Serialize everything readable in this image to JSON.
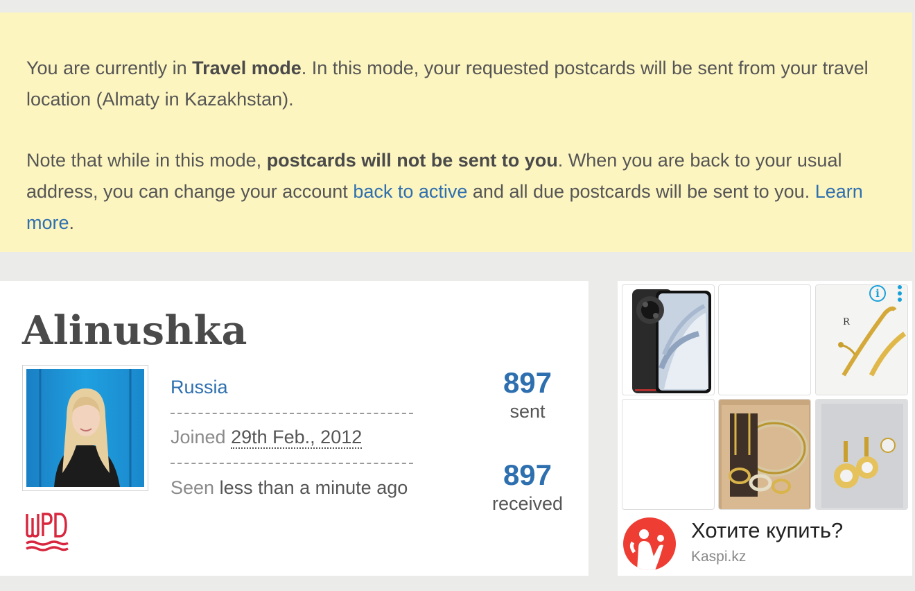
{
  "notice": {
    "p1_before": "You are currently in ",
    "p1_bold": "Travel mode",
    "p1_after": ". In this mode, your requested postcards will be sent from your travel location (Almaty in Kazakhstan).",
    "p2_before": "Note that while in this mode, ",
    "p2_bold": "postcards will not be sent to you",
    "p2_mid": ". When you are back to your usual address, you can change your account ",
    "p2_link": "back to active",
    "p2_after": " and all due postcards will be sent to you. ",
    "p2_learn": "Learn more",
    "p2_end": "."
  },
  "profile": {
    "username": "Alinushka",
    "country": "Russia",
    "joined_label": "Joined",
    "joined_date": "29th Feb., 2012",
    "seen_label": "Seen",
    "seen_value": "less than a minute ago",
    "badge": "WPD"
  },
  "stats": {
    "sent_count": "897",
    "sent_label": "sent",
    "received_count": "897",
    "received_label": "received"
  },
  "ad": {
    "title": "Хотите купить?",
    "domain": "Kaspi.kz",
    "info_icon": "info-icon",
    "menu_icon": "vertical-dots-icon",
    "jewelry_letter": "R"
  },
  "colors": {
    "notice_bg": "#fdf5c0",
    "link": "#2e6faf",
    "badge_red": "#d7263d",
    "ad_accent": "#19a0d8",
    "kaspi_red": "#ee3e34"
  }
}
